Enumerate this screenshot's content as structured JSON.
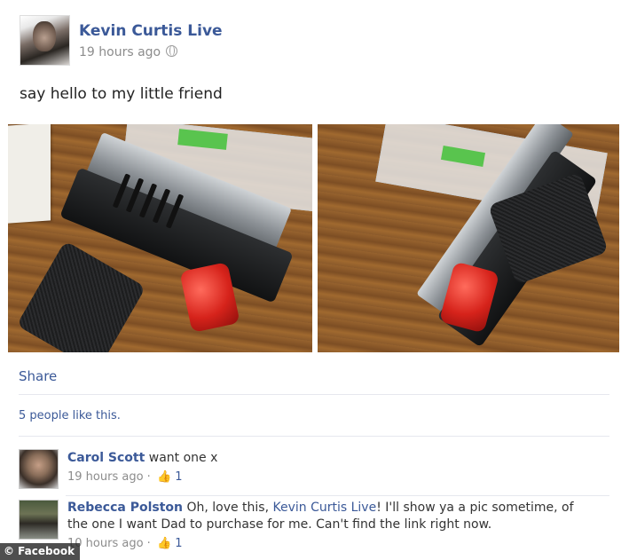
{
  "post": {
    "author": "Kevin Curtis Live",
    "timestamp": "19 hours ago",
    "privacy_icon": "globe-icon",
    "status": "say hello to my little friend",
    "photos": [
      {
        "subject": "pistol-with-red-cap-left"
      },
      {
        "subject": "pistol-with-red-cap-right"
      }
    ],
    "share_label": "Share",
    "likes_text": "5 people like this."
  },
  "comments": [
    {
      "name": "Carol Scott",
      "text": " want one x",
      "timestamp": "19 hours ago",
      "separator": " · ",
      "like_icon": "thumbs-up-icon",
      "likes": "1"
    },
    {
      "name": "Rebecca Polston",
      "text_before": " Oh, love this, ",
      "link_text": "Kevin Curtis Live",
      "text_after": "! I'll show ya a pic sometime, of the one I want Dad to purchase for me. Can't find the link right now.",
      "timestamp": "10 hours ago",
      "separator": " · ",
      "like_icon": "thumbs-up-icon",
      "likes": "1"
    }
  ],
  "watermark": "© Facebook",
  "colors": {
    "link_blue": "#3b5998",
    "meta_gray": "#8c8c8c",
    "divider": "#e6e8ee"
  }
}
